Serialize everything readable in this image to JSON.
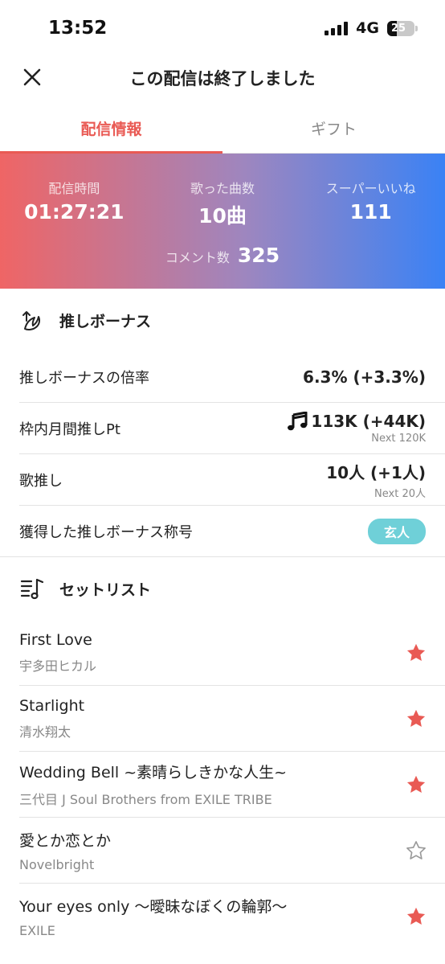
{
  "status": {
    "time": "13:52",
    "network": "4G",
    "battery": "25"
  },
  "header": {
    "title": "この配信は終了しました"
  },
  "tabs": [
    {
      "label": "配信情報",
      "active": true
    },
    {
      "label": "ギフト",
      "active": false
    }
  ],
  "stats": {
    "duration_label": "配信時間",
    "duration_value": "01:27:21",
    "songs_label": "歌った曲数",
    "songs_value": "10曲",
    "superlike_label": "スーパーいいね",
    "superlike_value": "111",
    "comments_label": "コメント数",
    "comments_value": "325"
  },
  "bonus": {
    "title": "推しボーナス",
    "rate_label": "推しボーナスの倍率",
    "rate_value": "6.3% (+3.3%)",
    "monthly_label": "枠内月間推しPt",
    "monthly_value": "113K (+44K)",
    "monthly_next": "Next 120K",
    "song_label": "歌推し",
    "song_value": "10人 (+1人)",
    "song_next": "Next 20人",
    "title_label": "獲得した推しボーナス称号",
    "title_badge": "玄人"
  },
  "setlist": {
    "title": "セットリスト",
    "songs": [
      {
        "title": "First Love",
        "artist": "宇多田ヒカル",
        "starred": true
      },
      {
        "title": "Starlight",
        "artist": "清水翔太",
        "starred": true
      },
      {
        "title": "Wedding Bell ~素晴らしきかな人生~",
        "artist": "三代目 J Soul Brothers from EXILE TRIBE",
        "starred": true
      },
      {
        "title": "愛とか恋とか",
        "artist": "Novelbright",
        "starred": false
      },
      {
        "title": "Your eyes only 〜曖昧なぼくの輪郭〜",
        "artist": "EXILE",
        "starred": true
      }
    ]
  },
  "colors": {
    "accent": "#e95a54",
    "star": "#e95a54",
    "badge": "#6fd0d8",
    "gradient_start": "#ef6565",
    "gradient_end": "#3a82f5"
  }
}
